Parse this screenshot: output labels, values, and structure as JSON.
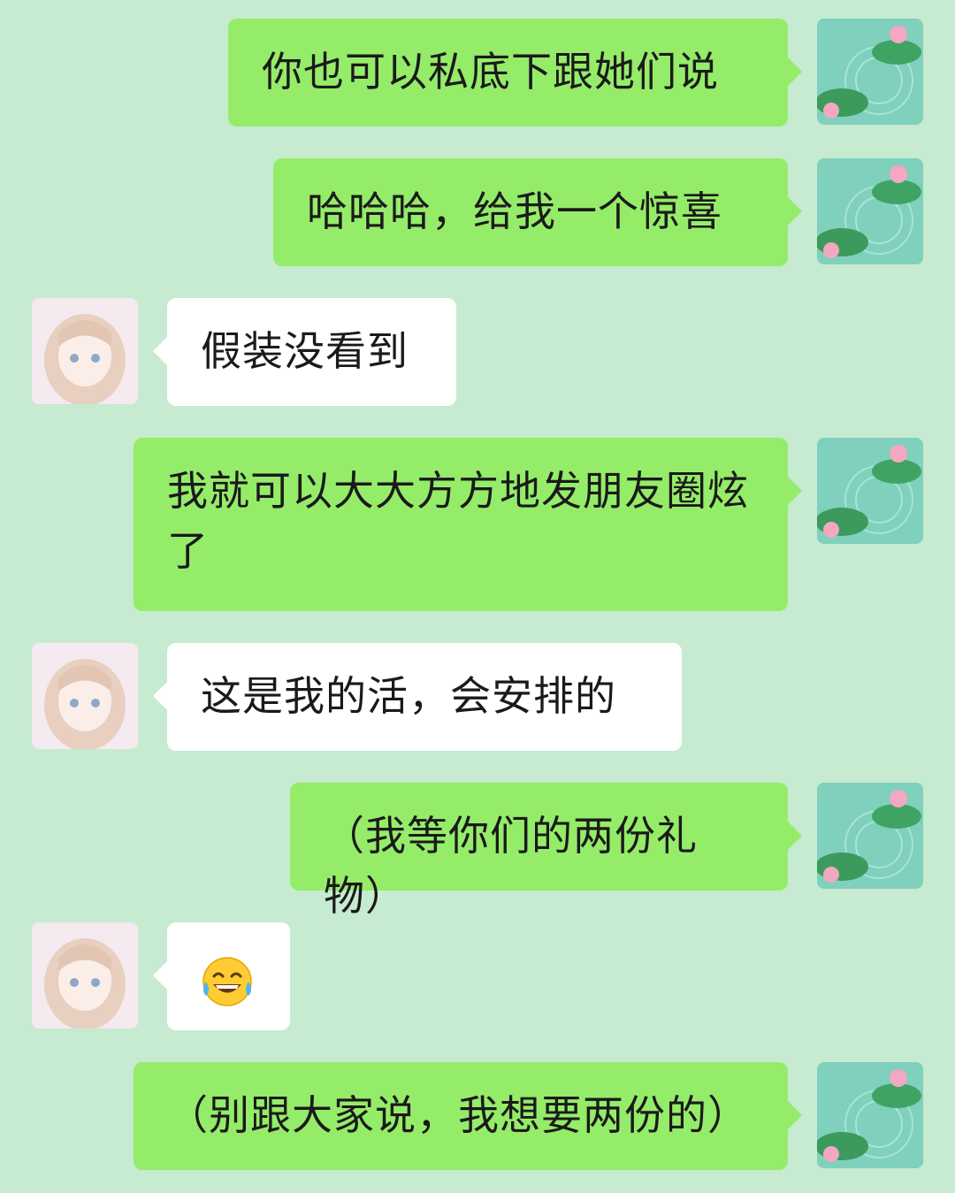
{
  "chat": {
    "messages": [
      {
        "side": "me",
        "text": "你也可以私底下跟她们说"
      },
      {
        "side": "me",
        "text": "哈哈哈，给我一个惊喜"
      },
      {
        "side": "them",
        "text": "假装没看到"
      },
      {
        "side": "me",
        "text": "我就可以大大方方地发朋友圈炫了"
      },
      {
        "side": "them",
        "text": "这是我的活，会安排的"
      },
      {
        "side": "me",
        "text": "（我等你们的两份礼物）"
      },
      {
        "side": "them",
        "emoji": "joy-tears-emoji"
      },
      {
        "side": "me",
        "text": "（别跟大家说，我想要两份的）"
      }
    ]
  },
  "avatars": {
    "me_icon": "lotus-pond-avatar",
    "them_icon": "anime-girl-avatar"
  },
  "colors": {
    "background": "#c6ebd0",
    "my_bubble": "#95ec69",
    "their_bubble": "#ffffff"
  }
}
